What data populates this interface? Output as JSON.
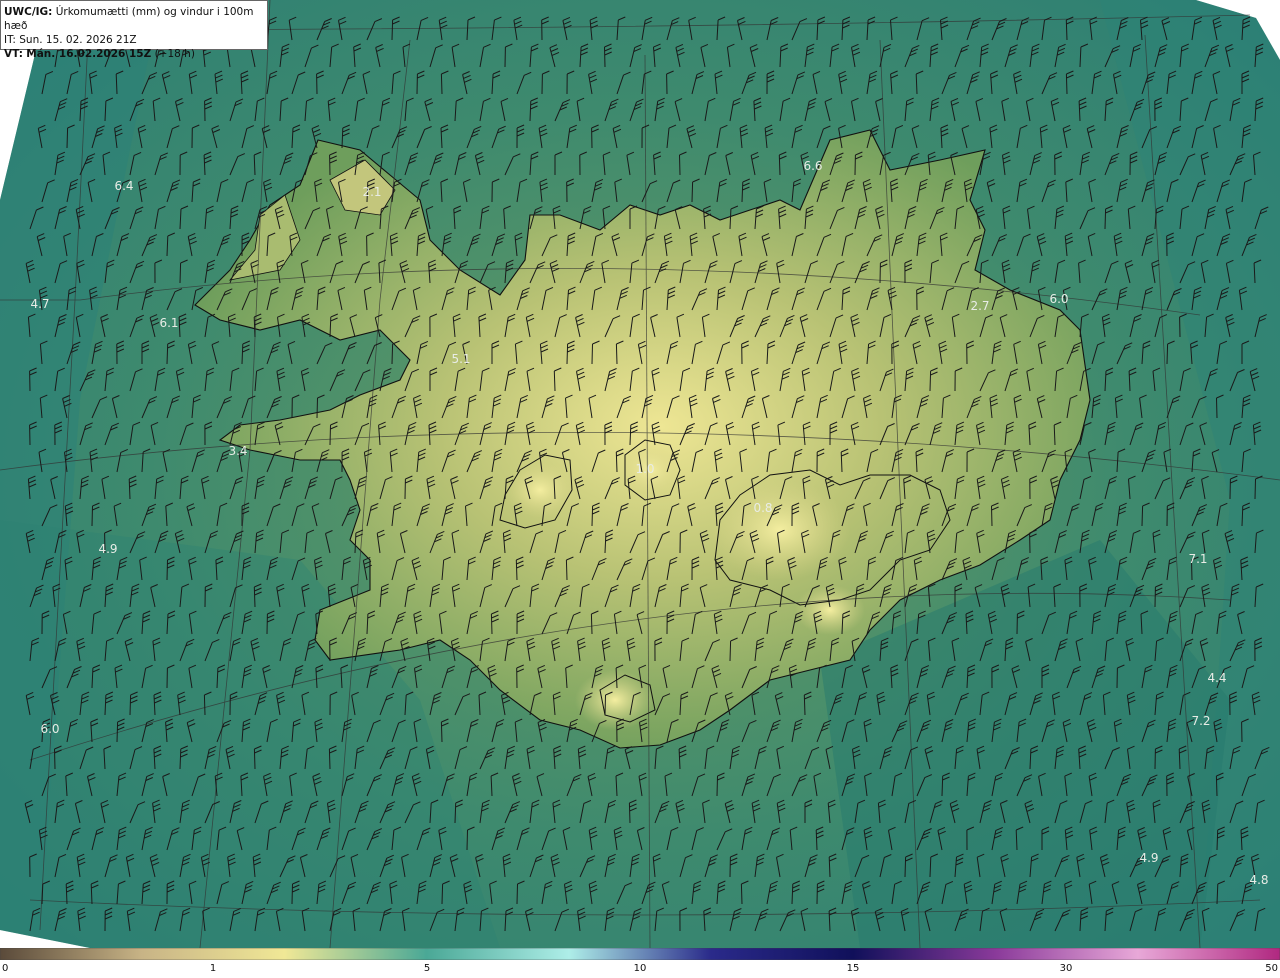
{
  "header": {
    "product": "UWC/IG:",
    "title": "Úrkomumætti (mm) og vindur i 100m hæð",
    "it_label": "IT:",
    "it_value": "Sun. 15. 02. 2026 21Z",
    "vt_label": "VT:",
    "vt_value": "Mán. 16.02.2026 15Z",
    "vt_offset": "(+18 h)"
  },
  "map_values": [
    {
      "label": "6.4",
      "value": 6.4
    },
    {
      "label": "4.7",
      "value": 4.7
    },
    {
      "label": "6.1",
      "value": 6.1
    },
    {
      "label": "4.9",
      "value": 4.9
    },
    {
      "label": "6.0",
      "value": 6.0
    },
    {
      "label": "6.6",
      "value": 6.6
    },
    {
      "label": "5.1",
      "value": 5.1
    },
    {
      "label": "6.0",
      "value": 6.0
    },
    {
      "label": "2.7",
      "value": 2.7
    },
    {
      "label": "7.1",
      "value": 7.1
    },
    {
      "label": "4.4",
      "value": 4.4
    },
    {
      "label": "7.2",
      "value": 7.2
    },
    {
      "label": "4.9",
      "value": 4.9
    },
    {
      "label": "4.8",
      "value": 4.8
    },
    {
      "label": "3.4",
      "value": 3.4
    },
    {
      "label": "1.0",
      "value": 1.0
    },
    {
      "label": "0.8",
      "value": 0.8
    },
    {
      "label": "2.1",
      "value": 2.1
    }
  ],
  "colorbar": {
    "ticks": [
      "0",
      "1",
      "5",
      "10",
      "15",
      "30",
      "50"
    ],
    "colors": [
      "#5a4a3a",
      "#c8b486",
      "#f0e896",
      "#4aa896",
      "#aeeee8",
      "#2a2a8a",
      "#10105a",
      "#8a3a9a",
      "#e8a8d8",
      "#b02880"
    ]
  },
  "colors": {
    "sea": "#2f8a78",
    "land_low": "#7aa45e",
    "land_high": "#e8e08a",
    "coast": "#111111"
  }
}
